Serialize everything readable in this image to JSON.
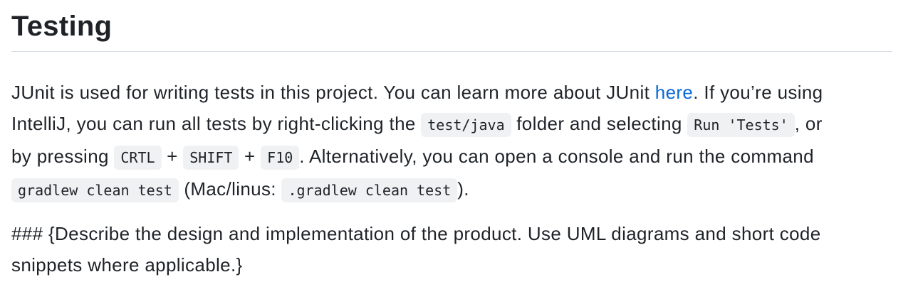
{
  "heading": "Testing",
  "para1": {
    "l1a": "JUnit is used for writing tests in this project. You can learn more about JUnit ",
    "link": "here",
    "l1b": ". If you’re using",
    "l2a": "IntelliJ, you can run all tests by right-clicking the ",
    "code_test_java": "test/java",
    "l2b": " folder and selecting ",
    "code_run_tests": "Run 'Tests'",
    "l2c": ", or",
    "l3a": "by pressing ",
    "code_crtl": "CRTL",
    "plus1": " + ",
    "code_shift": "SHIFT",
    "plus2": " + ",
    "code_f10": "F10",
    "l3b": ". Alternatively, you can open a console and run the command",
    "code_gradlew": "gradlew clean test",
    "l4a": " (Mac/linus: ",
    "code_gradlew_mac": ".gradlew clean test",
    "l4b": ")."
  },
  "para2": {
    "l1": "### {Describe the design and implementation of the product. Use UML diagrams and short code",
    "l2": "snippets where applicable.}"
  },
  "colors": {
    "link": "#0969da",
    "code_bg": "#eff1f3",
    "text": "#1f2328"
  }
}
